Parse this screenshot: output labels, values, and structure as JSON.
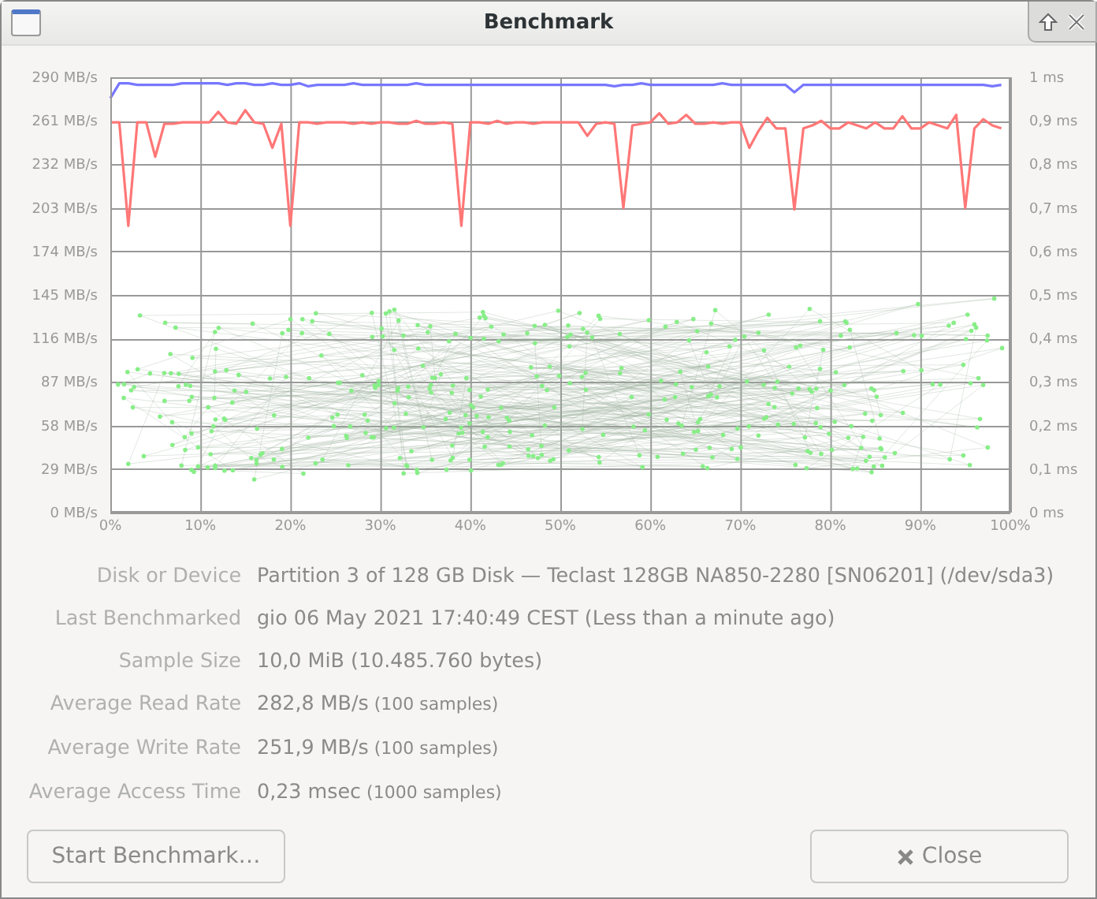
{
  "window": {
    "title": "Benchmark"
  },
  "chart": {
    "chart_data": {
      "type": "line",
      "grid": true,
      "x": [
        0,
        1,
        2,
        3,
        4,
        5,
        6,
        7,
        8,
        9,
        10,
        11,
        12,
        13,
        14,
        15,
        16,
        17,
        18,
        19,
        20,
        21,
        22,
        23,
        24,
        25,
        26,
        27,
        28,
        29,
        30,
        31,
        32,
        33,
        34,
        35,
        36,
        37,
        38,
        39,
        40,
        41,
        42,
        43,
        44,
        45,
        46,
        47,
        48,
        49,
        50,
        51,
        52,
        53,
        54,
        55,
        56,
        57,
        58,
        59,
        60,
        61,
        62,
        63,
        64,
        65,
        66,
        67,
        68,
        69,
        70,
        71,
        72,
        73,
        74,
        75,
        76,
        77,
        78,
        79,
        80,
        81,
        82,
        83,
        84,
        85,
        86,
        87,
        88,
        89,
        90,
        91,
        92,
        93,
        94,
        95,
        96,
        97,
        98,
        99
      ],
      "xlim": [
        0,
        100
      ],
      "ylim": [
        0,
        290
      ],
      "xticks": [
        {
          "value": 0,
          "label": "0%"
        },
        {
          "value": 10,
          "label": "10%"
        },
        {
          "value": 20,
          "label": "20%"
        },
        {
          "value": 30,
          "label": "30%"
        },
        {
          "value": 40,
          "label": "40%"
        },
        {
          "value": 50,
          "label": "50%"
        },
        {
          "value": 60,
          "label": "60%"
        },
        {
          "value": 70,
          "label": "70%"
        },
        {
          "value": 80,
          "label": "80%"
        },
        {
          "value": 90,
          "label": "90%"
        },
        {
          "value": 100,
          "label": "100%"
        }
      ],
      "yticks": [
        {
          "value": 0,
          "label": "0 MB/s"
        },
        {
          "value": 29,
          "label": "29 MB/s"
        },
        {
          "value": 58,
          "label": "58 MB/s"
        },
        {
          "value": 87,
          "label": "87 MB/s"
        },
        {
          "value": 116,
          "label": "116 MB/s"
        },
        {
          "value": 145,
          "label": "145 MB/s"
        },
        {
          "value": 174,
          "label": "174 MB/s"
        },
        {
          "value": 203,
          "label": "203 MB/s"
        },
        {
          "value": 232,
          "label": "232 MB/s"
        },
        {
          "value": 261,
          "label": "261 MB/s"
        },
        {
          "value": 290,
          "label": "290 MB/s"
        }
      ],
      "y2ticks": [
        "0 ms",
        "0,1 ms",
        "0,2 ms",
        "0,3 ms",
        "0,4 ms",
        "0,5 ms",
        "0,6 ms",
        "0,7 ms",
        "0,8 ms",
        "0,9 ms",
        "1 ms"
      ],
      "series": [
        {
          "color": "#7777ff",
          "values": [
            276,
            286,
            286,
            285,
            285,
            285,
            285,
            285,
            286,
            286,
            286,
            286,
            286,
            285,
            286,
            286,
            285,
            285,
            286,
            285,
            285,
            286,
            284,
            285,
            285,
            285,
            285,
            286,
            285,
            285,
            285,
            285,
            285,
            285,
            286,
            285,
            285,
            285,
            285,
            285,
            285,
            285,
            285,
            285,
            285,
            285,
            285,
            285,
            285,
            285,
            285,
            285,
            285,
            285,
            285,
            285,
            284,
            285,
            285,
            286,
            285,
            285,
            285,
            285,
            285,
            285,
            285,
            285,
            286,
            285,
            285,
            285,
            285,
            285,
            285,
            285,
            280,
            285,
            285,
            285,
            285,
            285,
            285,
            285,
            285,
            285,
            285,
            285,
            285,
            285,
            285,
            285,
            285,
            285,
            285,
            285,
            285,
            285,
            284,
            285
          ]
        },
        {
          "color": "#ff7777",
          "values": [
            260,
            260,
            191,
            260,
            260,
            237,
            259,
            259,
            260,
            260,
            260,
            260,
            267,
            260,
            259,
            268,
            260,
            259,
            243,
            259,
            191,
            260,
            260,
            259,
            260,
            260,
            260,
            259,
            260,
            259,
            260,
            260,
            259,
            259,
            261,
            259,
            259,
            260,
            259,
            191,
            260,
            260,
            259,
            261,
            259,
            260,
            260,
            259,
            260,
            260,
            260,
            260,
            260,
            251,
            259,
            260,
            259,
            203,
            258,
            259,
            260,
            266,
            259,
            260,
            265,
            259,
            259,
            260,
            259,
            260,
            260,
            243,
            254,
            263,
            256,
            256,
            202,
            256,
            258,
            261,
            256,
            256,
            260,
            258,
            256,
            260,
            256,
            256,
            264,
            256,
            256,
            260,
            258,
            256,
            265,
            203,
            256,
            262,
            258,
            256
          ]
        }
      ]
    }
  },
  "details": [
    {
      "label": "Disk or Device",
      "value": "Partition 3 of 128 GB Disk — Teclast 128GB NA850-2280 [SN06201] (/dev/sda3)"
    },
    {
      "label": "Last Benchmarked",
      "value": "gio 06 May 2021 17:40:49 CEST (Less than a minute ago)"
    },
    {
      "label": "Sample Size",
      "value": "10,0 MiB (10.485.760 bytes)"
    },
    {
      "label": "Average Read Rate",
      "value": "282,8 MB/s",
      "note": "(100 samples)"
    },
    {
      "label": "Average Write Rate",
      "value": "251,9 MB/s",
      "note": "(100 samples)"
    },
    {
      "label": "Average Access Time",
      "value": "0,23 msec",
      "note": "(1000 samples)"
    }
  ],
  "buttons": [
    {
      "label": "Start Benchmark…",
      "kind": "plain"
    },
    {
      "label": "Close",
      "kind": "close"
    }
  ]
}
